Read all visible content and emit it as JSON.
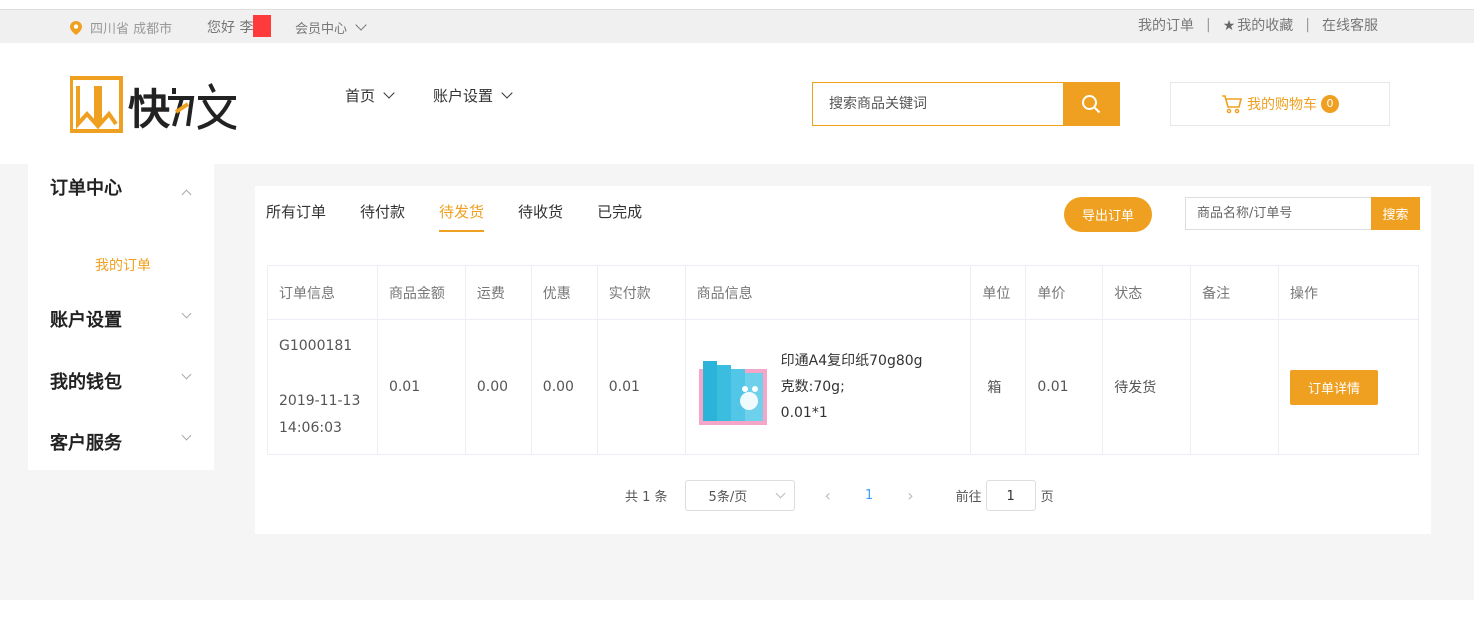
{
  "topbar": {
    "location": "四川省 成都市",
    "greeting": "您好 李",
    "member_center": "会员中心",
    "my_orders": "我的订单",
    "my_favorites": "我的收藏",
    "online_service": "在线客服",
    "separator": "|"
  },
  "header": {
    "logo_text": "快力文",
    "nav": [
      {
        "label": "首页"
      },
      {
        "label": "账户设置"
      }
    ],
    "search_placeholder": "搜索商品关键词",
    "cart_label": "我的购物车",
    "cart_count": "0"
  },
  "sidebar": {
    "groups": [
      {
        "label": "订单中心",
        "expanded": true,
        "items": [
          "我的订单"
        ]
      },
      {
        "label": "账户设置",
        "expanded": false
      },
      {
        "label": "我的钱包",
        "expanded": false
      },
      {
        "label": "客户服务",
        "expanded": false
      }
    ]
  },
  "main": {
    "tabs": [
      "所有订单",
      "待付款",
      "待发货",
      "待收货",
      "已完成"
    ],
    "active_tab": "待发货",
    "export_button": "导出订单",
    "order_search_placeholder": "商品名称/订单号",
    "order_search_button": "搜索",
    "table": {
      "columns": [
        "订单信息",
        "商品金额",
        "运费",
        "优惠",
        "实付款",
        "商品信息",
        "单位",
        "单价",
        "状态",
        "备注",
        "操作"
      ],
      "rows": [
        {
          "order_no": "G1000181",
          "date": "2019-11-13",
          "time": "14:06:03",
          "goods_amount": "0.01",
          "shipping": "0.00",
          "discount": "0.00",
          "paid": "0.01",
          "product_name": "印通A4复印纸70g80g",
          "product_spec": "克数:70g;",
          "product_qty": "0.01*1",
          "unit": "箱",
          "unit_price": "0.01",
          "status": "待发货",
          "remark": "",
          "action": "订单详情"
        }
      ]
    },
    "pagination": {
      "total": "共 1 条",
      "page_size": "5条/页",
      "current_page": "1",
      "goto_label": "前往",
      "goto_value": "1",
      "page_suffix": "页"
    }
  },
  "colors": {
    "accent": "#f0a020",
    "link": "#409eff"
  }
}
